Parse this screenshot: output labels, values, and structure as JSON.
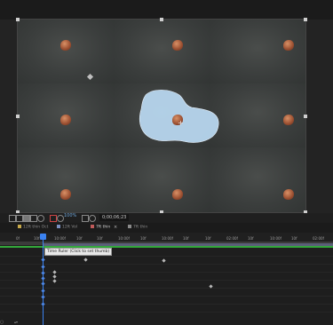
{
  "viewer": {
    "zoom": "100%",
    "timecode": "0;00;06;23"
  },
  "tabs": [
    {
      "label": "12ft thin Oct",
      "swatch": "#c7a94a"
    },
    {
      "label": "12ft Vol",
      "swatch": "#7a8fc0"
    },
    {
      "label": "7ft thin",
      "swatch": "#c05a5a",
      "active": true,
      "close": "×"
    },
    {
      "label": "7ft thin",
      "swatch": "#8a8a8a"
    }
  ],
  "ruler": {
    "ticks": [
      "0f",
      "10f",
      "10:00f",
      "10f",
      "10f",
      "10:00f",
      "10f",
      "10:00f",
      "10f",
      "10f",
      "02:00f",
      "10f",
      "10:00f",
      "10f",
      "02:00f"
    ]
  },
  "timeline": {
    "tooltip": "Time Ruler (Click to set thumb)",
    "footer_icon": "○",
    "footer_label": "▴▾"
  },
  "colors": {
    "playhead": "#3b82f0",
    "green_bar": "#33a83b",
    "work_area": "#5a5f78",
    "mask_fill": "#b7d6ee"
  },
  "icons": [
    "grid-icon",
    "safe-zone-icon",
    "channel-icon",
    "mask-icon",
    "region-icon",
    "color-picker-icon",
    "camera-icon",
    "snapshot-icon"
  ]
}
